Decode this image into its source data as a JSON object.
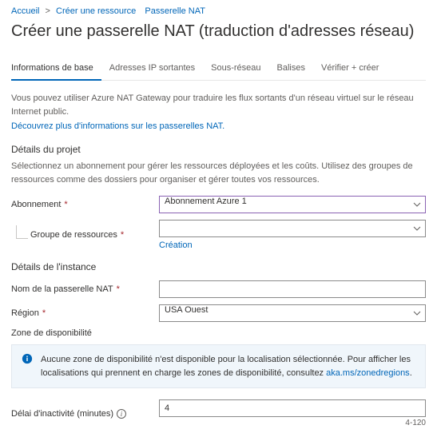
{
  "breadcrumb": {
    "home": "Accueil",
    "create": "Créer une ressource",
    "nat": "Passerelle NAT"
  },
  "title": "Créer une passerelle NAT (traduction d'adresses réseau)",
  "tabs": {
    "basics": "Informations de base",
    "outbound": "Adresses IP sortantes",
    "subnet": "Sous-réseau",
    "tags": "Balises",
    "review": "Vérifier + créer"
  },
  "intro": {
    "desc": "Vous pouvez utiliser Azure NAT Gateway pour traduire les flux sortants d'un réseau virtuel sur le réseau Internet public.",
    "link": "Découvrez plus d'informations sur les passerelles NAT."
  },
  "project": {
    "title": "Détails du projet",
    "desc": "Sélectionnez un abonnement pour gérer les ressources déployées et les coûts. Utilisez des groupes de ressources comme des dossiers pour organiser et gérer toutes vos ressources.",
    "subscription_label": "Abonnement",
    "subscription_value": "Abonnement Azure 1",
    "rg_label": "Groupe de ressources",
    "rg_value": "",
    "rg_create": "Création"
  },
  "instance": {
    "title": "Détails de l'instance",
    "name_label": "Nom de la passerelle NAT",
    "name_value": "",
    "region_label": "Région",
    "region_value": "USA Ouest",
    "zone_label": "Zone de disponibilité",
    "zone_value": ""
  },
  "info": {
    "text": "Aucune zone de disponibilité n'est disponible pour la localisation sélectionnée. Pour afficher les localisations qui prennent en charge les zones de disponibilité, consultez",
    "link": "aka.ms/zonedregions",
    "period": "."
  },
  "idle": {
    "label": "Délai d'inactivité (minutes)",
    "value": "4",
    "range": "4-120"
  }
}
